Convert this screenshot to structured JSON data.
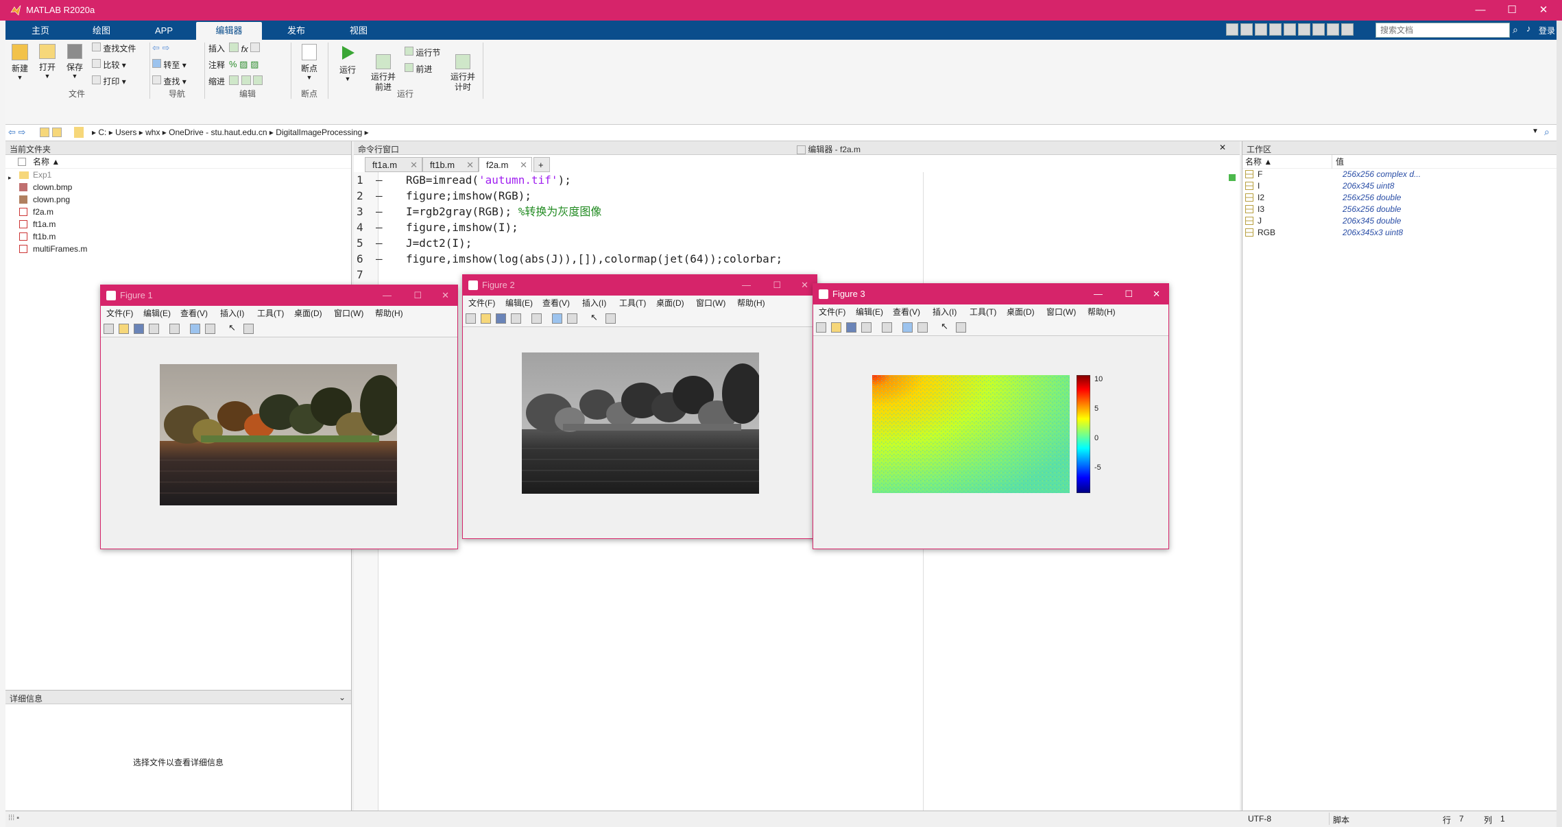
{
  "app": {
    "title": "MATLAB R2020a"
  },
  "ribbon_tabs": [
    "主页",
    "绘图",
    "APP",
    "编辑器",
    "发布",
    "视图"
  ],
  "active_tab": "编辑器",
  "search": {
    "placeholder": "搜索文档"
  },
  "user": {
    "login": "登录"
  },
  "ribbon": {
    "file_group": {
      "new": "新建",
      "open": "打开",
      "save": "保存",
      "find_files": "查找文件",
      "compare": "比较",
      "print": "打印",
      "label": "文件"
    },
    "nav_group": {
      "goto": "转至",
      "find": "查找",
      "label": "导航"
    },
    "edit_group": {
      "insert": "插入",
      "comment": "注释",
      "indent": "缩进",
      "fx": "fx",
      "label": "编辑"
    },
    "breakpoint_group": {
      "breakpoints": "断点",
      "label": "断点"
    },
    "run_group": {
      "run": "运行",
      "run_advance": "运行并\n前进",
      "run_section": "运行节",
      "advance": "前进",
      "run_time": "运行并\n计时",
      "label": "运行"
    }
  },
  "address": [
    "C:",
    "Users",
    "whx",
    "OneDrive - stu.haut.edu.cn",
    "DigitalImageProcessing"
  ],
  "file_panel": {
    "title": "当前文件夹",
    "col_name": "名称 ▲",
    "items": [
      "Exp1",
      "clown.bmp",
      "clown.png",
      "f2a.m",
      "ft1a.m",
      "ft1b.m",
      "multiFrames.m"
    ]
  },
  "details_panel": {
    "title": "详细信息",
    "hint": "选择文件以查看详细信息"
  },
  "command_window": {
    "title": "命令行窗口"
  },
  "editor": {
    "title": "编辑器 - f2a.m",
    "tabs": [
      "ft1a.m",
      "ft1b.m",
      "f2a.m"
    ],
    "active_tab": "f2a.m",
    "lines": [
      {
        "n": "1",
        "pre": "RGB=imread(",
        "str": "'autumn.tif'",
        "post": ");",
        "cmt": ""
      },
      {
        "n": "2",
        "pre": "figure;imshow(RGB);",
        "str": "",
        "post": "",
        "cmt": ""
      },
      {
        "n": "3",
        "pre": "I=rgb2gray(RGB); ",
        "str": "",
        "post": "",
        "cmt": "%转换为灰度图像"
      },
      {
        "n": "4",
        "pre": "figure,imshow(I);",
        "str": "",
        "post": "",
        "cmt": ""
      },
      {
        "n": "5",
        "pre": "J=dct2(I);",
        "str": "",
        "post": "",
        "cmt": ""
      },
      {
        "n": "6",
        "pre": "figure,imshow(log(abs(J)),[]),colormap(jet(64));colorbar;",
        "str": "",
        "post": "",
        "cmt": ""
      },
      {
        "n": "7",
        "pre": "",
        "str": "",
        "post": "",
        "cmt": ""
      }
    ]
  },
  "workspace": {
    "title": "工作区",
    "col_name": "名称 ▲",
    "col_value": "值",
    "vars": [
      {
        "name": "F",
        "value": "256x256 complex d..."
      },
      {
        "name": "I",
        "value": "206x345 uint8"
      },
      {
        "name": "I2",
        "value": "256x256 double"
      },
      {
        "name": "I3",
        "value": "256x256 double"
      },
      {
        "name": "J",
        "value": "206x345 double"
      },
      {
        "name": "RGB",
        "value": "206x345x3 uint8"
      }
    ]
  },
  "status": {
    "encoding": "UTF-8",
    "type": "脚本",
    "row_label": "行",
    "row": "7",
    "col_label": "列",
    "col": "1"
  },
  "figure_menu": [
    "文件(F)",
    "编辑(E)",
    "查看(V)",
    "插入(I)",
    "工具(T)",
    "桌面(D)",
    "窗口(W)",
    "帮助(H)"
  ],
  "figures": [
    {
      "title": "Figure 1"
    },
    {
      "title": "Figure 2"
    },
    {
      "title": "Figure 3"
    }
  ],
  "colorbar": {
    "ticks": [
      "10",
      "5",
      "0",
      "-5"
    ]
  },
  "colors": {
    "accent": "#d6246a",
    "ribbon_blue": "#0a4d8c",
    "string": "#a020f0",
    "comment": "#228b22"
  }
}
